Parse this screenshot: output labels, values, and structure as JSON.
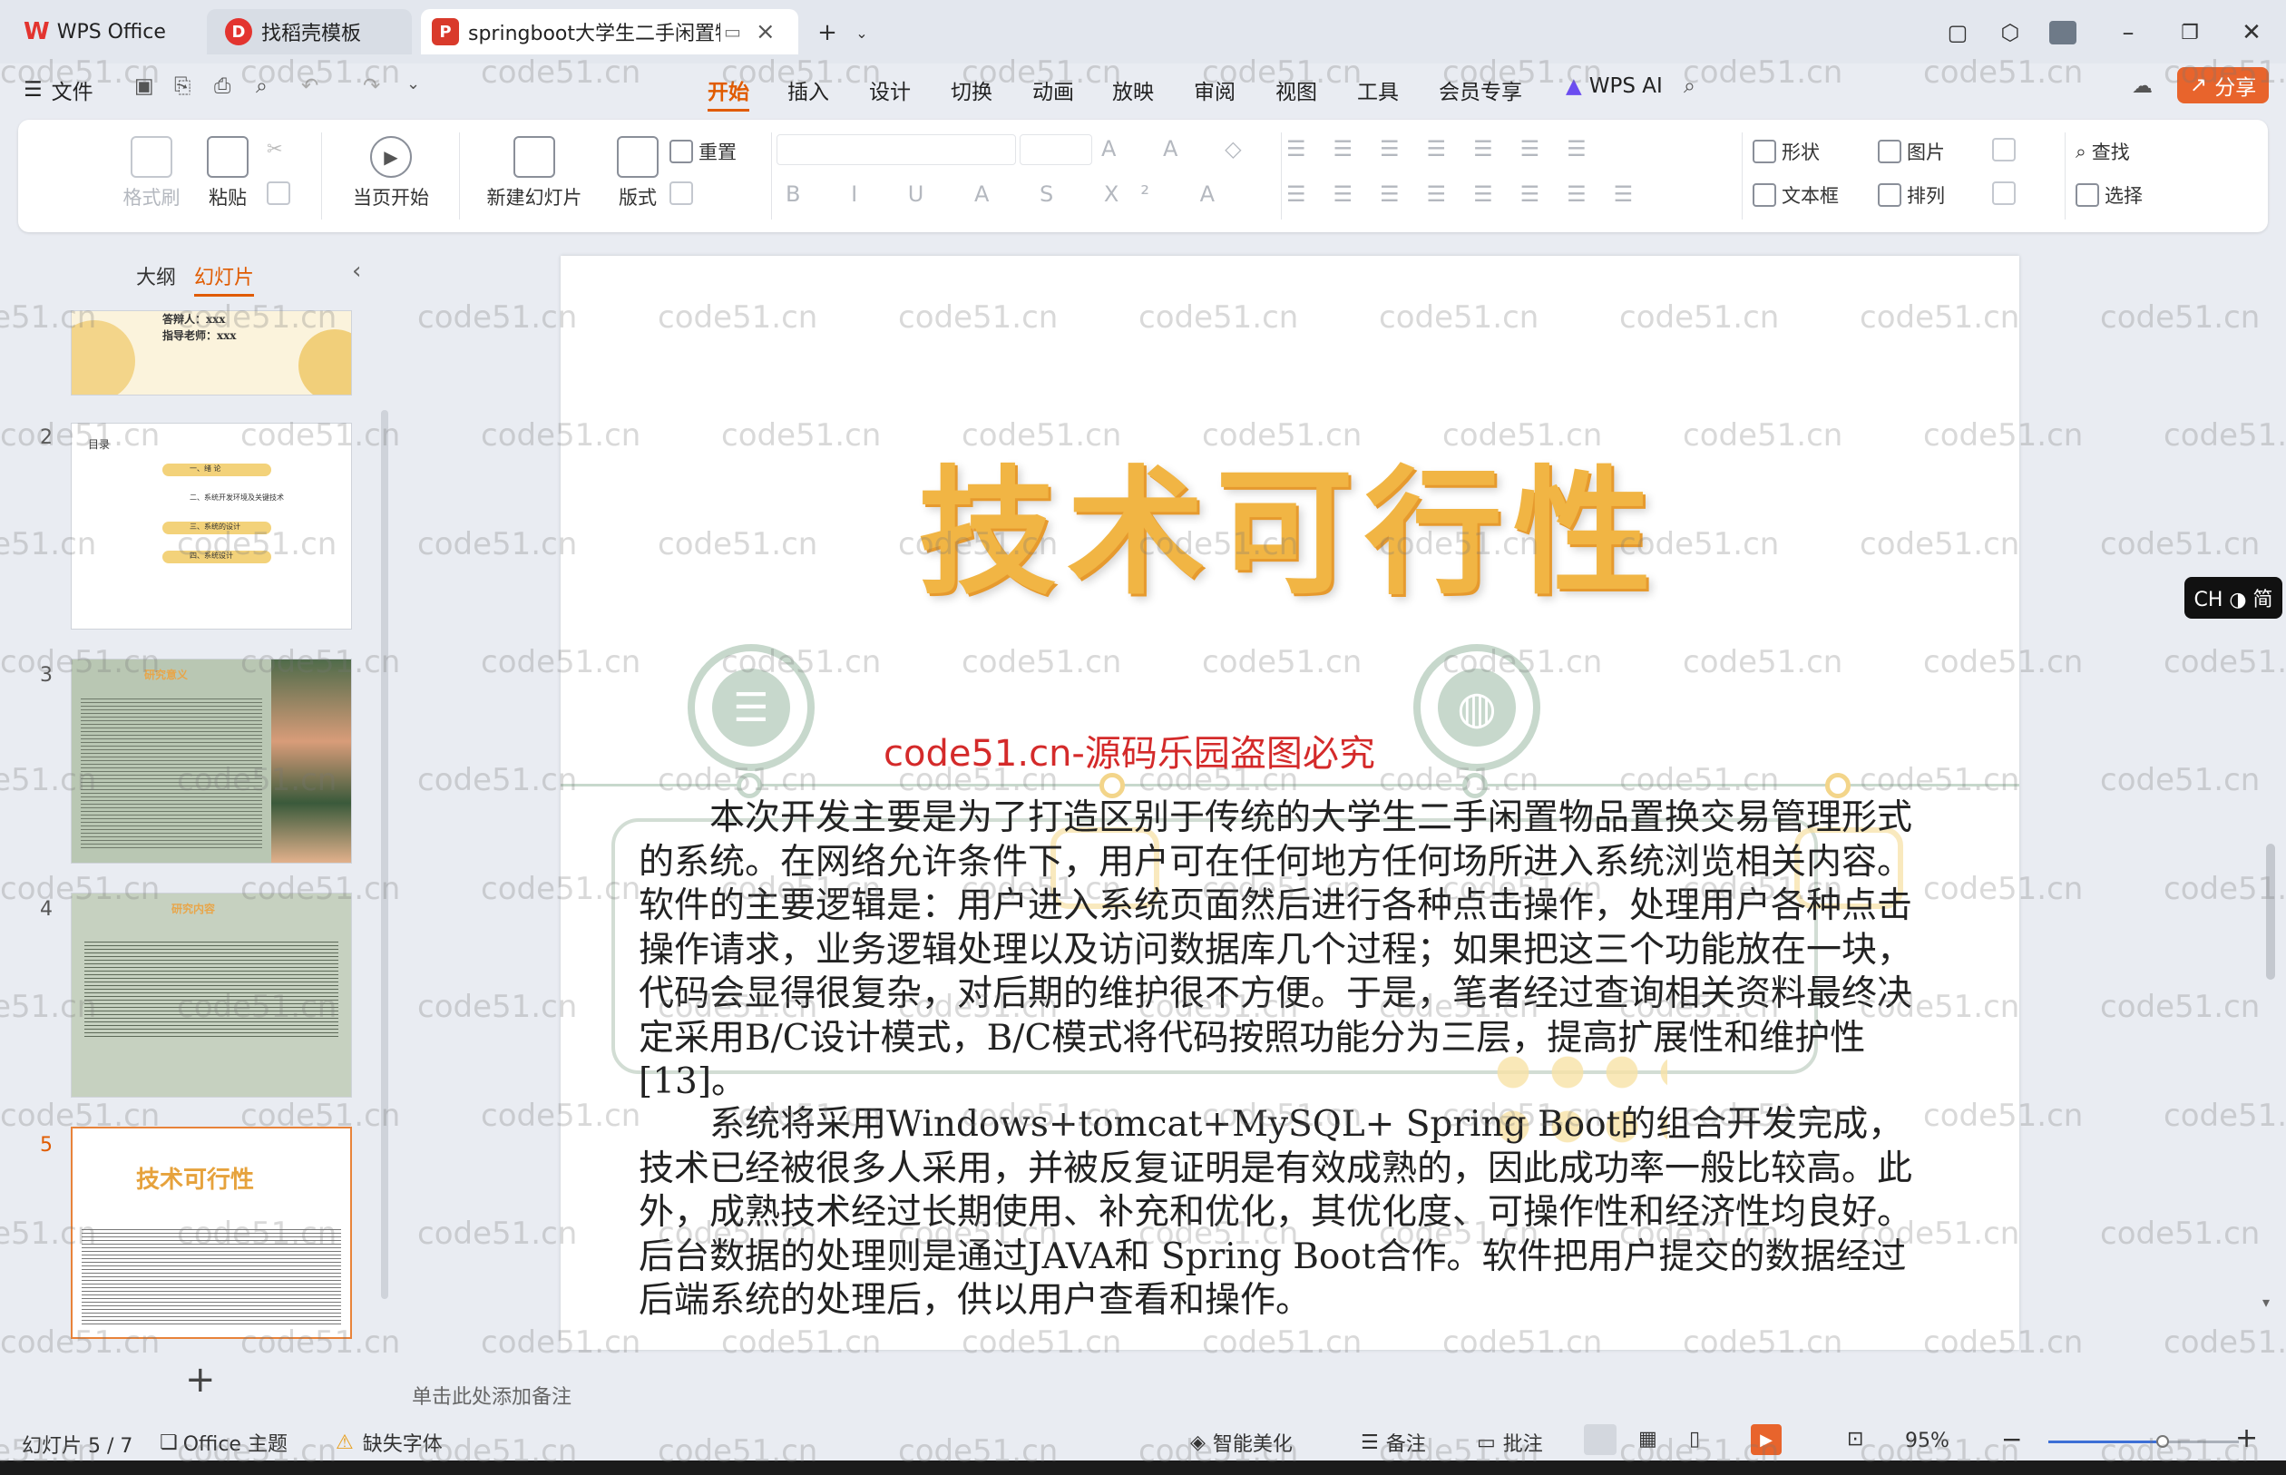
{
  "tabs": [
    {
      "label": "WPS Office",
      "color": "#e3342f",
      "logo": "W"
    },
    {
      "label": "找稻壳模板",
      "color": "#e3342f",
      "logo": "D"
    },
    {
      "label": "springboot大学生二手闲置物",
      "color": "#d93a2b",
      "logo": "P"
    }
  ],
  "menu": {
    "file": "文件",
    "items": [
      "开始",
      "插入",
      "设计",
      "切换",
      "动画",
      "放映",
      "审阅",
      "视图",
      "工具",
      "会员专享"
    ],
    "ai": "WPS AI",
    "share": "分享",
    "active_color": "#e05b00"
  },
  "ribbon": {
    "format_painter": "格式刷",
    "paste": "粘贴",
    "play_from": "当页开始",
    "new_slide": "新建幻灯片",
    "layout": "版式",
    "reset": "重置",
    "shape": "形状",
    "picture": "图片",
    "find": "查找",
    "textbox": "文本框",
    "arrange": "排列",
    "select": "选择"
  },
  "panel": {
    "outline": "大纲",
    "slides": "幻灯片",
    "numbers": [
      "2",
      "3",
      "4",
      "5"
    ],
    "t1_line1": "答辩人：xxx",
    "t1_line2": "指导老师：xxx",
    "t2_title": "目录",
    "t2_items": [
      "一、绪 论",
      "二、系统开发环境及关键技术",
      "三、系统的设计",
      "四、系统设计"
    ],
    "t3_title": "研究意义",
    "t4_title": "研究内容",
    "t5_title": "技术可行性"
  },
  "slide": {
    "title": "技术可行性",
    "watermark_red": "code51.cn-源码乐园盗图必究",
    "para1": "本次开发主要是为了打造区别于传统的大学生二手闲置物品置换交易管理形式的系统。在网络允许条件下，用户可在任何地方任何场所进入系统浏览相关内容。软件的主要逻辑是：用户进入系统页面然后进行各种点击操作，处理用户各种点击操作请求，业务逻辑处理以及访问数据库几个过程；如果把这三个功能放在一块，代码会显得很复杂，对后期的维护很不方便。于是，笔者经过查询相关资料最终决定采用B/C设计模式，B/C模式将代码按照功能分为三层，提高扩展性和维护性[13]。",
    "para2": "系统将采用Windows+tomcat+MySQL+ Spring Boot的组合开发完成，技术已经被很多人采用，并被反复证明是有效成熟的，因此成功率一般比较高。此外，成熟技术经过长期使用、补充和优化，其优化度、可操作性和经济性均良好。后台数据的处理则是通过JAVA和 Spring Boot合作。软件把用户提交的数据经过后端系统的处理后，供以用户查看和操作。"
  },
  "notes_placeholder": "单击此处添加备注",
  "ime": "CH ◑ 简",
  "status": {
    "slide_count": "幻灯片 5 / 7",
    "theme": "Office 主题",
    "missing_font": "缺失字体",
    "beautify": "智能美化",
    "notes": "备注",
    "comments": "批注",
    "zoom": "95%",
    "zoom_level": 0.6
  },
  "watermark": "code51.cn"
}
